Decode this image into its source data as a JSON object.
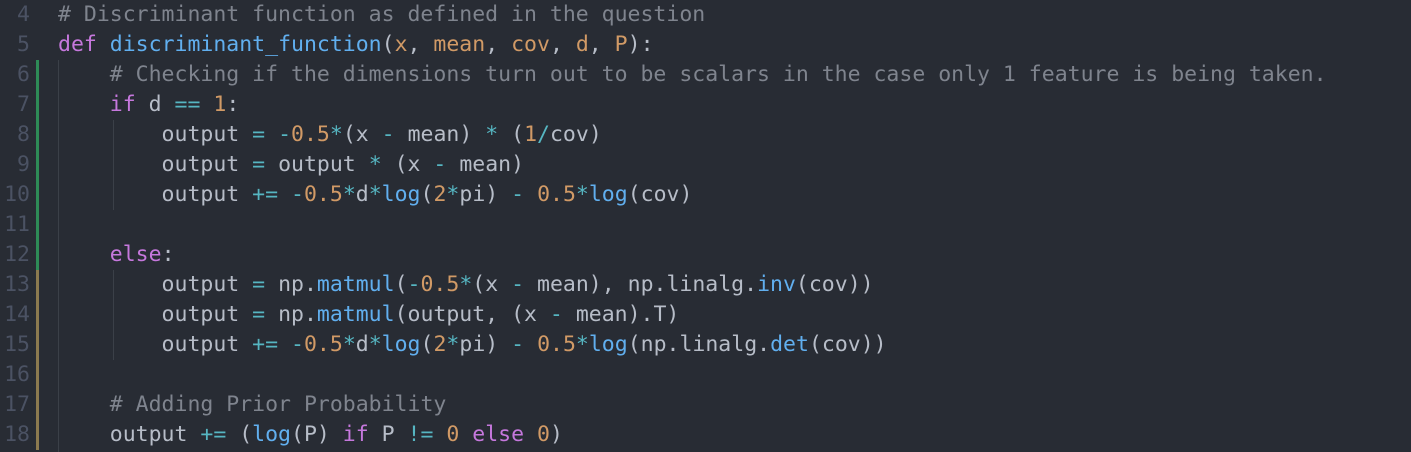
{
  "colors": {
    "background": "#282c34",
    "comment": "#7f848e",
    "keyword": "#c678dd",
    "function": "#61afef",
    "parameter": "#d19a66",
    "number": "#d19a66",
    "operator": "#56b6c2",
    "text": "#b7bdc8",
    "git_added": "#2e8b57",
    "git_modified": "#8c7a4f",
    "line_number": "#4b5263"
  },
  "editor": {
    "lines": [
      {
        "number": "4",
        "git": "none",
        "tokens": [
          {
            "t": "cm",
            "v": "# Discriminant function as defined in the question"
          }
        ]
      },
      {
        "number": "5",
        "git": "none",
        "tokens": [
          {
            "t": "kw",
            "v": "def"
          },
          {
            "t": "tx",
            "v": " "
          },
          {
            "t": "fn",
            "v": "discriminant_function"
          },
          {
            "t": "tx",
            "v": "("
          },
          {
            "t": "pr",
            "v": "x"
          },
          {
            "t": "tx",
            "v": ", "
          },
          {
            "t": "pr",
            "v": "mean"
          },
          {
            "t": "tx",
            "v": ", "
          },
          {
            "t": "pr",
            "v": "cov"
          },
          {
            "t": "tx",
            "v": ", "
          },
          {
            "t": "pr",
            "v": "d"
          },
          {
            "t": "tx",
            "v": ", "
          },
          {
            "t": "pr",
            "v": "P"
          },
          {
            "t": "tx",
            "v": "):"
          }
        ]
      },
      {
        "number": "6",
        "git": "added",
        "tokens": [
          {
            "t": "tx",
            "v": "    "
          },
          {
            "t": "cm",
            "v": "# Checking if the dimensions turn out to be scalars in the case only 1 feature is being taken."
          }
        ]
      },
      {
        "number": "7",
        "git": "added",
        "tokens": [
          {
            "t": "tx",
            "v": "    "
          },
          {
            "t": "kw",
            "v": "if"
          },
          {
            "t": "tx",
            "v": " d "
          },
          {
            "t": "op",
            "v": "=="
          },
          {
            "t": "tx",
            "v": " "
          },
          {
            "t": "nu",
            "v": "1"
          },
          {
            "t": "tx",
            "v": ":"
          }
        ]
      },
      {
        "number": "8",
        "git": "added",
        "tokens": [
          {
            "t": "tx",
            "v": "        output "
          },
          {
            "t": "op",
            "v": "="
          },
          {
            "t": "tx",
            "v": " "
          },
          {
            "t": "op",
            "v": "-"
          },
          {
            "t": "nu",
            "v": "0.5"
          },
          {
            "t": "op",
            "v": "*"
          },
          {
            "t": "tx",
            "v": "(x "
          },
          {
            "t": "op",
            "v": "-"
          },
          {
            "t": "tx",
            "v": " mean) "
          },
          {
            "t": "op",
            "v": "*"
          },
          {
            "t": "tx",
            "v": " ("
          },
          {
            "t": "nu",
            "v": "1"
          },
          {
            "t": "op",
            "v": "/"
          },
          {
            "t": "tx",
            "v": "cov)"
          }
        ]
      },
      {
        "number": "9",
        "git": "added",
        "tokens": [
          {
            "t": "tx",
            "v": "        output "
          },
          {
            "t": "op",
            "v": "="
          },
          {
            "t": "tx",
            "v": " output "
          },
          {
            "t": "op",
            "v": "*"
          },
          {
            "t": "tx",
            "v": " (x "
          },
          {
            "t": "op",
            "v": "-"
          },
          {
            "t": "tx",
            "v": " mean)"
          }
        ]
      },
      {
        "number": "10",
        "git": "added",
        "tokens": [
          {
            "t": "tx",
            "v": "        output "
          },
          {
            "t": "op",
            "v": "+="
          },
          {
            "t": "tx",
            "v": " "
          },
          {
            "t": "op",
            "v": "-"
          },
          {
            "t": "nu",
            "v": "0.5"
          },
          {
            "t": "op",
            "v": "*"
          },
          {
            "t": "tx",
            "v": "d"
          },
          {
            "t": "op",
            "v": "*"
          },
          {
            "t": "fn",
            "v": "log"
          },
          {
            "t": "tx",
            "v": "("
          },
          {
            "t": "nu",
            "v": "2"
          },
          {
            "t": "op",
            "v": "*"
          },
          {
            "t": "tx",
            "v": "pi) "
          },
          {
            "t": "op",
            "v": "-"
          },
          {
            "t": "tx",
            "v": " "
          },
          {
            "t": "nu",
            "v": "0.5"
          },
          {
            "t": "op",
            "v": "*"
          },
          {
            "t": "fn",
            "v": "log"
          },
          {
            "t": "tx",
            "v": "(cov)"
          }
        ]
      },
      {
        "number": "11",
        "git": "added",
        "tokens": []
      },
      {
        "number": "12",
        "git": "added",
        "tokens": [
          {
            "t": "tx",
            "v": "    "
          },
          {
            "t": "kw",
            "v": "else"
          },
          {
            "t": "tx",
            "v": ":"
          }
        ]
      },
      {
        "number": "13",
        "git": "modified",
        "tokens": [
          {
            "t": "tx",
            "v": "        output "
          },
          {
            "t": "op",
            "v": "="
          },
          {
            "t": "tx",
            "v": " np."
          },
          {
            "t": "fn",
            "v": "matmul"
          },
          {
            "t": "tx",
            "v": "("
          },
          {
            "t": "op",
            "v": "-"
          },
          {
            "t": "nu",
            "v": "0.5"
          },
          {
            "t": "op",
            "v": "*"
          },
          {
            "t": "tx",
            "v": "(x "
          },
          {
            "t": "op",
            "v": "-"
          },
          {
            "t": "tx",
            "v": " mean), np.linalg."
          },
          {
            "t": "fn",
            "v": "inv"
          },
          {
            "t": "tx",
            "v": "(cov))"
          }
        ]
      },
      {
        "number": "14",
        "git": "modified",
        "tokens": [
          {
            "t": "tx",
            "v": "        output "
          },
          {
            "t": "op",
            "v": "="
          },
          {
            "t": "tx",
            "v": " np."
          },
          {
            "t": "fn",
            "v": "matmul"
          },
          {
            "t": "tx",
            "v": "(output, (x "
          },
          {
            "t": "op",
            "v": "-"
          },
          {
            "t": "tx",
            "v": " mean).T)"
          }
        ]
      },
      {
        "number": "15",
        "git": "modified",
        "tokens": [
          {
            "t": "tx",
            "v": "        output "
          },
          {
            "t": "op",
            "v": "+="
          },
          {
            "t": "tx",
            "v": " "
          },
          {
            "t": "op",
            "v": "-"
          },
          {
            "t": "nu",
            "v": "0.5"
          },
          {
            "t": "op",
            "v": "*"
          },
          {
            "t": "tx",
            "v": "d"
          },
          {
            "t": "op",
            "v": "*"
          },
          {
            "t": "fn",
            "v": "log"
          },
          {
            "t": "tx",
            "v": "("
          },
          {
            "t": "nu",
            "v": "2"
          },
          {
            "t": "op",
            "v": "*"
          },
          {
            "t": "tx",
            "v": "pi) "
          },
          {
            "t": "op",
            "v": "-"
          },
          {
            "t": "tx",
            "v": " "
          },
          {
            "t": "nu",
            "v": "0.5"
          },
          {
            "t": "op",
            "v": "*"
          },
          {
            "t": "fn",
            "v": "log"
          },
          {
            "t": "tx",
            "v": "(np.linalg."
          },
          {
            "t": "fn",
            "v": "det"
          },
          {
            "t": "tx",
            "v": "(cov))"
          }
        ]
      },
      {
        "number": "16",
        "git": "modified",
        "tokens": []
      },
      {
        "number": "17",
        "git": "modified",
        "tokens": [
          {
            "t": "tx",
            "v": "    "
          },
          {
            "t": "cm",
            "v": "# Adding Prior Probability"
          }
        ]
      },
      {
        "number": "18",
        "git": "modified",
        "tokens": [
          {
            "t": "tx",
            "v": "    output "
          },
          {
            "t": "op",
            "v": "+="
          },
          {
            "t": "tx",
            "v": " ("
          },
          {
            "t": "fn",
            "v": "log"
          },
          {
            "t": "tx",
            "v": "(P) "
          },
          {
            "t": "kw",
            "v": "if"
          },
          {
            "t": "tx",
            "v": " P "
          },
          {
            "t": "op",
            "v": "!="
          },
          {
            "t": "tx",
            "v": " "
          },
          {
            "t": "nu",
            "v": "0"
          },
          {
            "t": "tx",
            "v": " "
          },
          {
            "t": "kw",
            "v": "else"
          },
          {
            "t": "tx",
            "v": " "
          },
          {
            "t": "nu",
            "v": "0"
          },
          {
            "t": "tx",
            "v": ")"
          }
        ]
      }
    ]
  }
}
